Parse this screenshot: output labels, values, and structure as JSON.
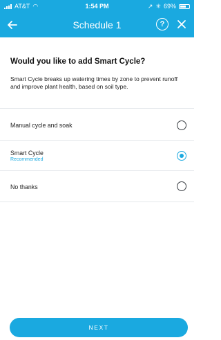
{
  "status_bar": {
    "carrier": "AT&T",
    "time": "1:54 PM",
    "battery": "69%",
    "icons": [
      "signal-icon",
      "wifi-icon",
      "location-icon",
      "bluetooth-icon",
      "battery-icon"
    ]
  },
  "nav": {
    "title": "Schedule 1",
    "back_icon": "arrow-left-icon",
    "help_icon": "help-icon",
    "close_icon": "close-icon"
  },
  "content": {
    "heading": "Would you like to add Smart Cycle?",
    "description": "Smart Cycle breaks up watering times by zone to prevent runoff and improve plant health, based on soil type."
  },
  "options": [
    {
      "label": "Manual cycle and soak",
      "sublabel": "",
      "selected": false
    },
    {
      "label": "Smart Cycle",
      "sublabel": "Recommended",
      "selected": true
    },
    {
      "label": "No thanks",
      "sublabel": "",
      "selected": false
    }
  ],
  "footer": {
    "next_label": "NEXT"
  },
  "colors": {
    "accent": "#1aa9e0",
    "text": "#222222",
    "divider": "#e4e8eb"
  }
}
